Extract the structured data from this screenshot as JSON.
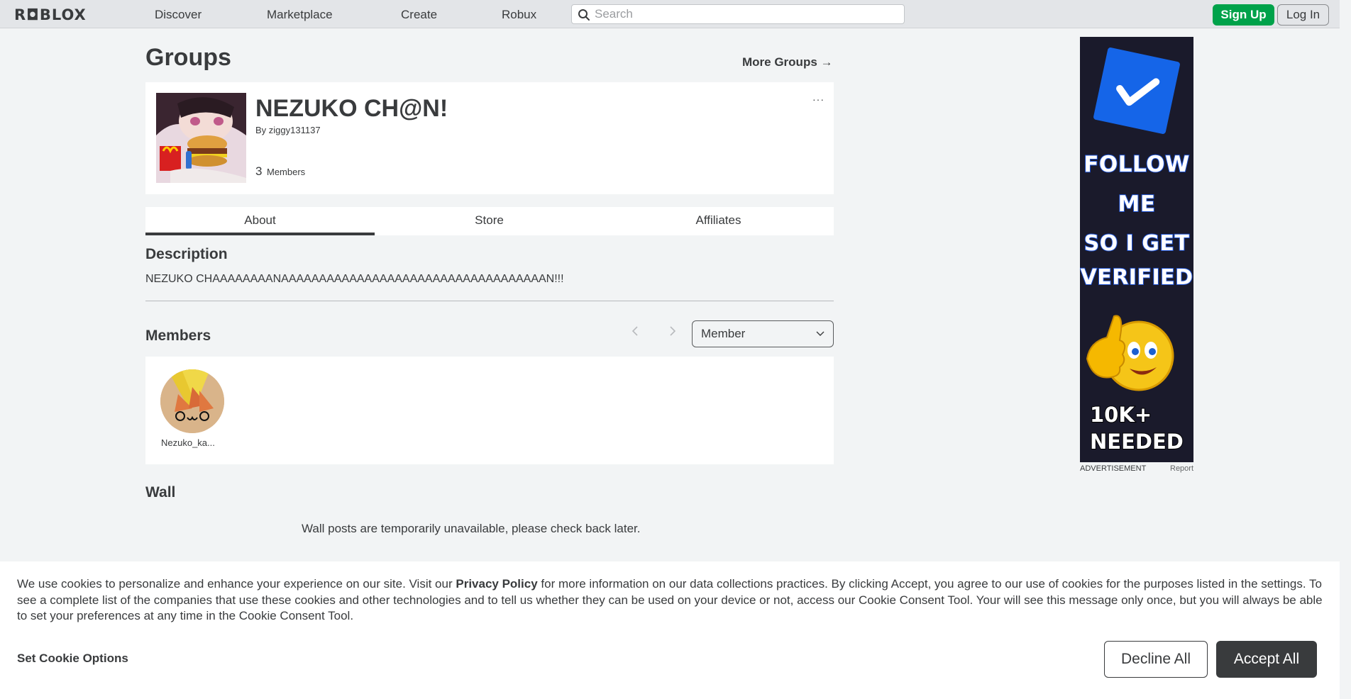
{
  "nav": {
    "logo": "R◘BLOX",
    "links": [
      "Discover",
      "Marketplace",
      "Create",
      "Robux"
    ],
    "search_placeholder": "Search",
    "signup": "Sign Up",
    "login": "Log In"
  },
  "page": {
    "title": "Groups",
    "more_groups": "More Groups →"
  },
  "group": {
    "name": "NEZUKO CH@N!",
    "by_prefix": "By",
    "owner": "ziggy131137",
    "member_count": "3",
    "members_label": "Members",
    "menu": "···"
  },
  "tabs": [
    "About",
    "Store",
    "Affiliates"
  ],
  "about": {
    "description_heading": "Description",
    "description": "NEZUKO CHAAAAAAAANAAAAAAAAAAAAAAAAAAAAAAAAAAAAAAAAAAAN!!!",
    "members_heading": "Members",
    "role_selected": "Member",
    "members": [
      {
        "name": "Nezuko_ka..."
      }
    ],
    "wall_heading": "Wall",
    "wall_message": "Wall posts are temporarily unavailable, please check back later."
  },
  "ad": {
    "line1": "FOLLOW",
    "line2": "ME",
    "line3": "SO I GET",
    "line4": "VERIFIED",
    "line5": "10K+",
    "line6": "NEEDED",
    "label": "ADVERTISEMENT",
    "report": "Report"
  },
  "cookie": {
    "text_before": "We use cookies to personalize and enhance your experience on our site. Visit our ",
    "policy_link": "Privacy Policy",
    "text_after": " for more information on our data collections practices. By clicking Accept, you agree to our use of cookies for the purposes listed in the settings. To see a complete list of the companies that use these cookies and other technologies and to tell us whether they can be used on your device or not, access our Cookie Consent Tool. Your will see this message only once, but you will always be able to set your preferences at any time in the Cookie Consent Tool.",
    "set_options": "Set Cookie Options",
    "decline": "Decline All",
    "accept": "Accept All"
  },
  "colors": {
    "signup_green": "#00a24a",
    "text_dark": "#393b3d",
    "background": "#f2f4f5",
    "ad_check_blue": "#1565e8"
  }
}
